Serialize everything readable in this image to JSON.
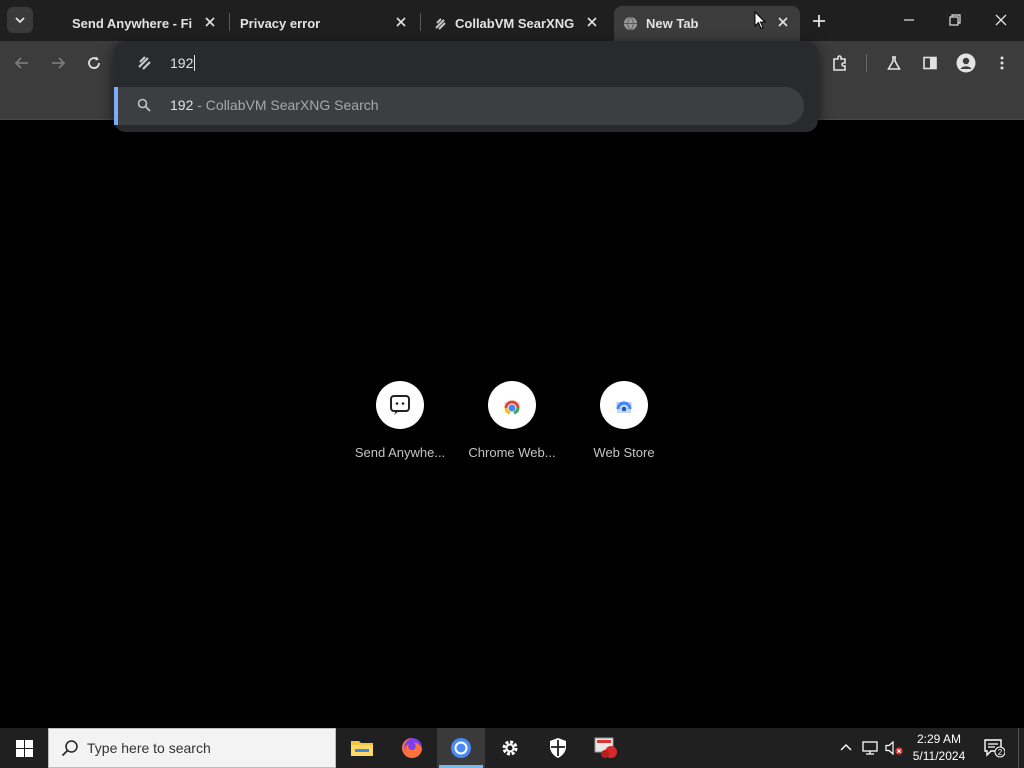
{
  "browser": {
    "tabs": [
      {
        "title": "Send Anywhere - File",
        "active": false
      },
      {
        "title": "Privacy error",
        "active": false
      },
      {
        "title": "CollabVM SearXNG",
        "active": false
      },
      {
        "title": "New Tab",
        "active": true
      }
    ],
    "omnibox": {
      "value": "192",
      "suggestion_query": "192",
      "suggestion_desc": " - CollabVM SearXNG Search"
    },
    "shortcuts": [
      {
        "label": "Send Anywhe..."
      },
      {
        "label": "Chrome Web..."
      },
      {
        "label": "Web Store"
      }
    ],
    "colors": {
      "accent": "#7cacf8",
      "tab_active": "#3c3c3c",
      "tabbar": "#1f1f1f"
    }
  },
  "taskbar": {
    "search_placeholder": "Type here to search",
    "apps": [
      "file-explorer",
      "firefox",
      "chrome",
      "settings",
      "security",
      "app-red"
    ],
    "clock_time": "2:29 AM",
    "clock_date": "5/11/2024",
    "notification_count": "2"
  }
}
